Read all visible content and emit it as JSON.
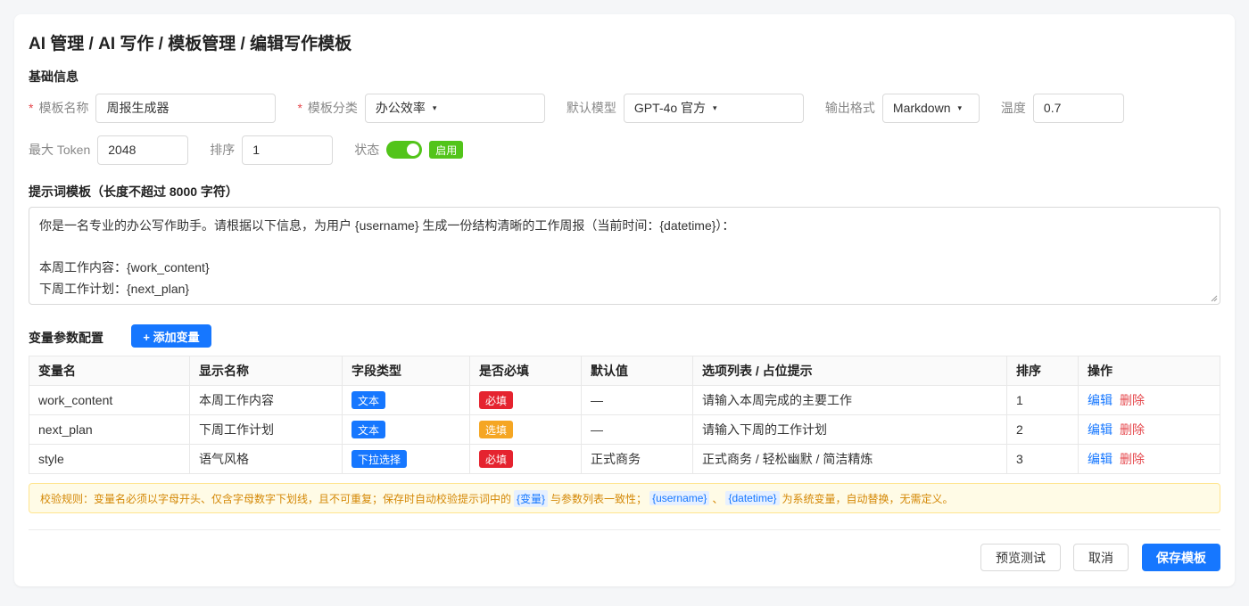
{
  "breadcrumb": "AI 管理 / AI 写作 / 模板管理 / 编辑写作模板",
  "basic": {
    "section_title": "基础信息",
    "name_label": "模板名称",
    "name_value": "周报生成器",
    "category_label": "模板分类",
    "category_value": "办公效率",
    "model_label": "默认模型",
    "model_value": "GPT-4o 官方",
    "format_label": "输出格式",
    "format_value": "Markdown",
    "temp_label": "温度",
    "temp_value": "0.7",
    "token_label": "最大 Token",
    "token_value": "2048",
    "sort_label": "排序",
    "sort_value": "1",
    "status_label": "状态",
    "status_value": "启用",
    "required_mark": "*",
    "caret": "▾"
  },
  "prompt": {
    "section_title": "提示词模板（长度不超过 8000 字符）",
    "lines": [
      "你是一名专业的办公写作助手。请根据以下信息，为用户 {username} 生成一份结构清晰的工作周报（当前时间：{datetime}）：",
      "",
      "本周工作内容：{work_content}",
      "下周工作计划：{next_plan}"
    ]
  },
  "variables": {
    "section_title": "变量参数配置",
    "add_button": "+ 添加变量",
    "headers": [
      "变量名",
      "显示名称",
      "字段类型",
      "是否必填",
      "默认值",
      "选项列表 / 占位提示",
      "排序",
      "操作"
    ],
    "rows": [
      {
        "name": "work_content",
        "display": "本周工作内容",
        "type": "文本",
        "type_color": "blue",
        "required": "必填",
        "required_color": "red",
        "default": "—",
        "options": "请输入本周完成的主要工作",
        "sort": "1"
      },
      {
        "name": "next_plan",
        "display": "下周工作计划",
        "type": "文本",
        "type_color": "blue",
        "required": "选填",
        "required_color": "orange",
        "default": "—",
        "options": "请输入下周的工作计划",
        "sort": "2"
      },
      {
        "name": "style",
        "display": "语气风格",
        "type": "下拉选择",
        "type_color": "blue",
        "required": "必填",
        "required_color": "red",
        "default": "正式商务",
        "options": "正式商务 / 轻松幽默 / 简洁精炼",
        "sort": "3"
      }
    ],
    "edit_label": "编辑",
    "delete_label": "删除"
  },
  "notice": {
    "part1": "校验规则：变量名必须以字母开头、仅含字母数字下划线，且不可重复；保存时自动校验提示词中的",
    "code1": "{变量}",
    "part2": "与参数列表一致性；",
    "code2": "{username}",
    "sep": "、",
    "code3": "{datetime}",
    "part3": "为系统变量，自动替换，无需定义。"
  },
  "actions": {
    "preview": "预览测试",
    "cancel": "取消",
    "save": "保存模板"
  },
  "colors": {
    "primary": "#1677ff",
    "success": "#52c41a",
    "danger": "#e5232f",
    "warning": "#f5a623"
  }
}
